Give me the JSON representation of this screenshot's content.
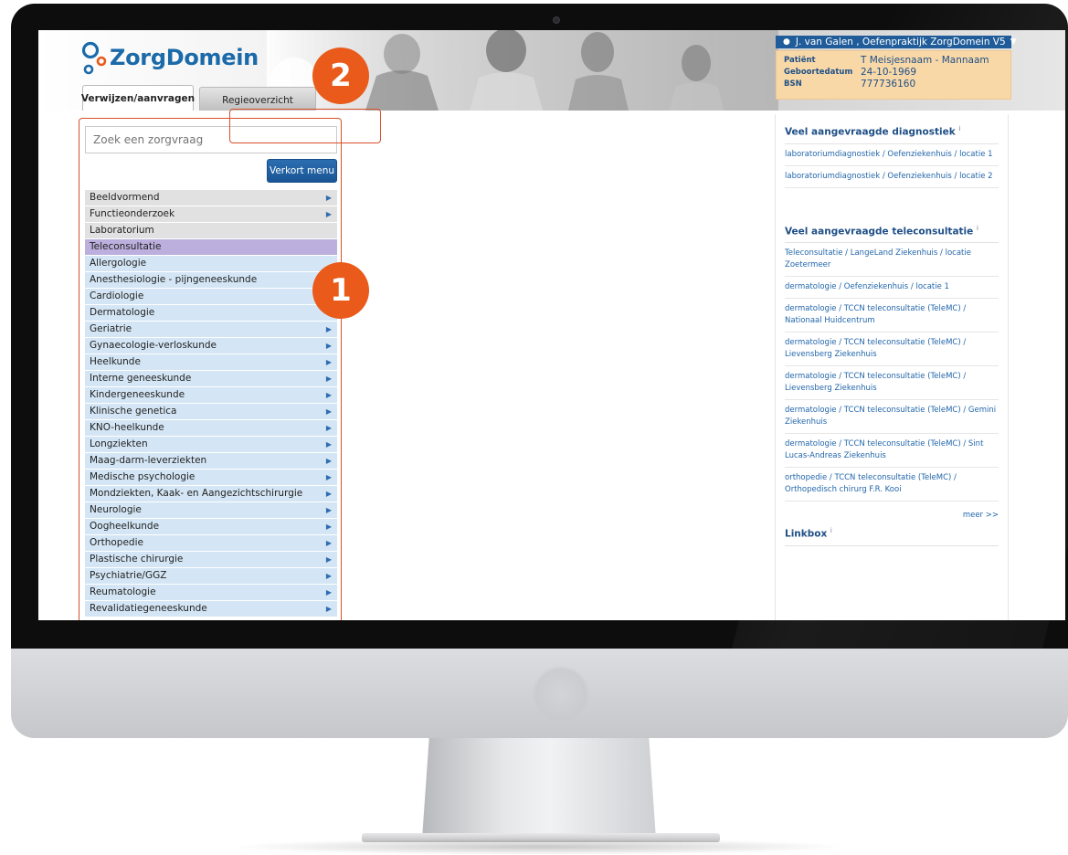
{
  "logo": {
    "text": "ZorgDomein"
  },
  "tabs": [
    {
      "label": "Verwijzen/aanvragen",
      "active": true
    },
    {
      "label": "Regieoverzicht",
      "active": false
    }
  ],
  "user": {
    "label": "J. van Galen , Oefenpraktijk ZorgDomein V5"
  },
  "patient": {
    "patient_label": "Patiënt",
    "patient_value": "T Meisjesnaam - Mannaam",
    "dob_label": "Geboortedatum",
    "dob_value": "24-10-1969",
    "bsn_label": "BSN",
    "bsn_value": "777736160"
  },
  "search": {
    "placeholder": "Zoek een zorgvraag"
  },
  "verkort_label": "Verkort menu",
  "menu": [
    {
      "label": "Beeldvormend",
      "color": "grey",
      "arrow": true
    },
    {
      "label": "Functieonderzoek",
      "color": "grey",
      "arrow": true
    },
    {
      "label": "Laboratorium",
      "color": "grey",
      "arrow": false
    },
    {
      "label": "Teleconsultatie",
      "color": "purple",
      "arrow": false
    },
    {
      "label": "Allergologie",
      "color": "blue",
      "arrow": false
    },
    {
      "label": "Anesthesiologie - pijngeneeskunde",
      "color": "blue",
      "arrow": false
    },
    {
      "label": "Cardiologie",
      "color": "blue",
      "arrow": false
    },
    {
      "label": "Dermatologie",
      "color": "blue",
      "arrow": false
    },
    {
      "label": "Geriatrie",
      "color": "blue",
      "arrow": true
    },
    {
      "label": "Gynaecologie-verloskunde",
      "color": "blue",
      "arrow": true
    },
    {
      "label": "Heelkunde",
      "color": "blue",
      "arrow": true
    },
    {
      "label": "Interne geneeskunde",
      "color": "blue",
      "arrow": true
    },
    {
      "label": "Kindergeneeskunde",
      "color": "blue",
      "arrow": true
    },
    {
      "label": "Klinische genetica",
      "color": "blue",
      "arrow": true
    },
    {
      "label": "KNO-heelkunde",
      "color": "blue",
      "arrow": true
    },
    {
      "label": "Longziekten",
      "color": "blue",
      "arrow": true
    },
    {
      "label": "Maag-darm-leverziekten",
      "color": "blue",
      "arrow": true
    },
    {
      "label": "Medische psychologie",
      "color": "blue",
      "arrow": true
    },
    {
      "label": "Mondziekten, Kaak- en Aangezichtschirurgie",
      "color": "blue",
      "arrow": true
    },
    {
      "label": "Neurologie",
      "color": "blue",
      "arrow": true
    },
    {
      "label": "Oogheelkunde",
      "color": "blue",
      "arrow": true
    },
    {
      "label": "Orthopedie",
      "color": "blue",
      "arrow": true
    },
    {
      "label": "Plastische chirurgie",
      "color": "blue",
      "arrow": true
    },
    {
      "label": "Psychiatrie/GGZ",
      "color": "blue",
      "arrow": true
    },
    {
      "label": "Reumatologie",
      "color": "blue",
      "arrow": true
    },
    {
      "label": "Revalidatiegeneeskunde",
      "color": "blue",
      "arrow": true
    }
  ],
  "diag": {
    "heading": "Veel aangevraagde diagnostiek",
    "links": [
      "laboratoriumdiagnostiek / Oefenziekenhuis / locatie 1",
      "laboratoriumdiagnostiek / Oefenziekenhuis / locatie 2"
    ]
  },
  "tele": {
    "heading": "Veel aangevraagde teleconsultatie",
    "links": [
      "Teleconsultatie / LangeLand Ziekenhuis / locatie Zoetermeer",
      "dermatologie / Oefenziekenhuis / locatie 1",
      "dermatologie / TCCN teleconsultatie (TeleMC) / Nationaal Huidcentrum",
      "dermatologie / TCCN teleconsultatie (TeleMC) / Lievensberg Ziekenhuis",
      "dermatologie / TCCN teleconsultatie (TeleMC) / Lievensberg Ziekenhuis",
      "dermatologie / TCCN teleconsultatie (TeleMC) / Gemini Ziekenhuis",
      "dermatologie / TCCN teleconsultatie (TeleMC) / Sint Lucas-Andreas Ziekenhuis",
      "orthopedie / TCCN teleconsultatie (TeleMC) / Orthopedisch chirurg F.R. Kooi"
    ],
    "meer": "meer >>"
  },
  "linkbox": {
    "heading": "Linkbox"
  },
  "info_symbol": "i",
  "callouts": {
    "one": "1",
    "two": "2"
  },
  "colors": {
    "brand": "#1b6aa9",
    "accent": "#ea5a1a",
    "selected": "#bcaedd",
    "menu_blue": "#d4e6f5"
  }
}
